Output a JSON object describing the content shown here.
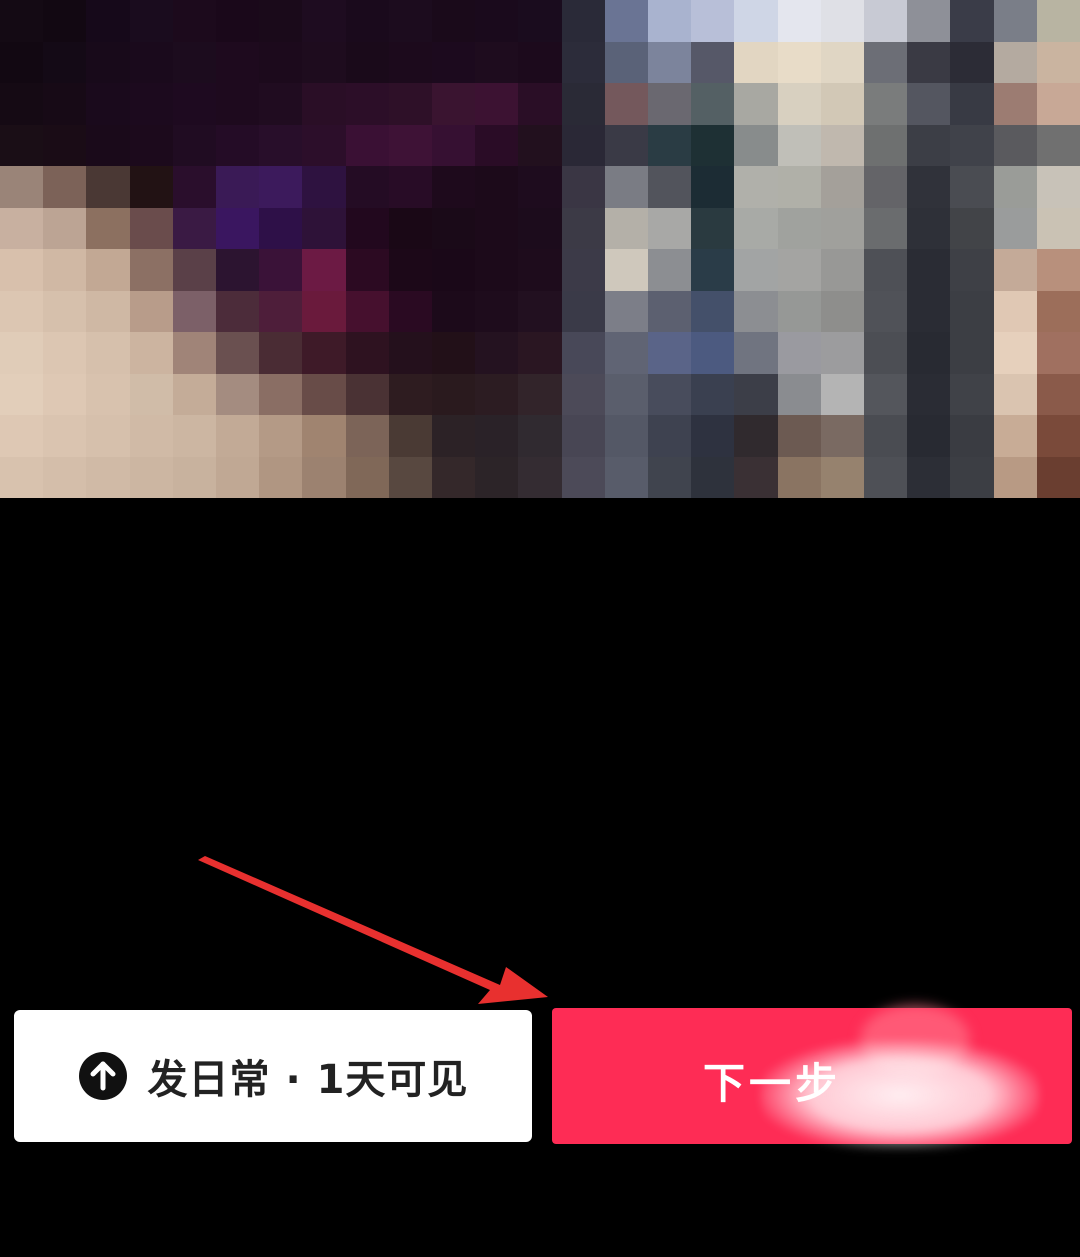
{
  "media_preview": {
    "description_icon": "pixelated-photo"
  },
  "bottom_bar": {
    "daily_button": {
      "icon": "arrow-up-circle-icon",
      "label": "发日常 · 1天可见"
    },
    "next_button": {
      "label": "下一步"
    }
  },
  "colors": {
    "next_button_bg": "#fe2c55",
    "daily_button_bg": "#ffffff",
    "annotation_arrow": "#e8302f",
    "background": "#000000"
  }
}
